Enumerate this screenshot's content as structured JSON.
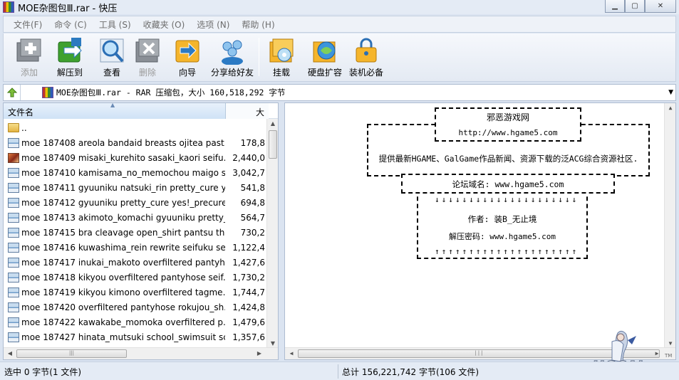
{
  "window": {
    "title": "MOE杂图包Ⅲ.rar - 快压"
  },
  "menu": [
    "文件(F)",
    "命令 (C)",
    "工具 (S)",
    "收藏夹 (O)",
    "选项 (N)",
    "帮助 (H)"
  ],
  "toolbar": {
    "add": "添加",
    "extract": "解压到",
    "view": "查看",
    "delete": "删除",
    "wizard": "向导",
    "share": "分享给好友",
    "mount": "挂载",
    "disk": "硬盘扩容",
    "essentials": "装机必备"
  },
  "address": {
    "text": "MOE杂图包Ⅲ.rar - RAR 压缩包，大小 160,518,292 字节"
  },
  "filelist": {
    "col_name": "文件名",
    "col_size": "大",
    "parent": "..",
    "rows": [
      {
        "icon": "image",
        "name": "moe 187408 areola bandaid breasts ojitea past...",
        "size": "178,8"
      },
      {
        "icon": "photo",
        "name": "moe 187409 misaki_kurehito sasaki_kaori seifu...",
        "size": "2,440,0"
      },
      {
        "icon": "image",
        "name": "moe 187410 kamisama_no_memochou maigo s...",
        "size": "3,042,7"
      },
      {
        "icon": "image",
        "name": "moe 187411 gyuuniku natsuki_rin pretty_cure y...",
        "size": "541,8"
      },
      {
        "icon": "image",
        "name": "moe 187412 gyuuniku pretty_cure yes!_precure...",
        "size": "694,8"
      },
      {
        "icon": "image",
        "name": "moe 187413 akimoto_komachi gyuuniku pretty_...",
        "size": "564,7"
      },
      {
        "icon": "image",
        "name": "moe 187415 bra cleavage open_shirt pantsu thi...",
        "size": "730,2"
      },
      {
        "icon": "image",
        "name": "moe 187416 kuwashima_rein rewrite seifuku se...",
        "size": "1,122,4"
      },
      {
        "icon": "image",
        "name": "moe 187417 inukai_makoto overfiltered pantyh...",
        "size": "1,427,6"
      },
      {
        "icon": "image",
        "name": "moe 187418 kikyou overfiltered pantyhose seif...",
        "size": "1,730,2"
      },
      {
        "icon": "image",
        "name": "moe 187419 kikyou kimono overfiltered tagme...",
        "size": "1,744,7"
      },
      {
        "icon": "image",
        "name": "moe 187420 overfiltered pantyhose rokujou_sh...",
        "size": "1,424,8"
      },
      {
        "icon": "image",
        "name": "moe 187422 kawakabe_momoka overfiltered p...",
        "size": "1,479,6"
      },
      {
        "icon": "image",
        "name": "moe 187427 hinata_mutsuki school_swimsuit sc...",
        "size": "1,357,6"
      }
    ]
  },
  "comment": {
    "site_name": "邪恶游戏网",
    "site_url": "http://www.hgame5.com",
    "description": "提供最新HGAME、GalGame作品新闻、资源下载的泛ACG综合资源社区.",
    "forum": "论坛域名: www.hgame5.com",
    "down_arrows": "↓↓↓↓↓↓↓↓↓↓↓↓↓↓↓↓↓↓↓↓↓",
    "author": "作者: 装B_无止境",
    "password": "解压密码: www.hgame5.com",
    "up_arrows": "↑↑↑↑↑↑↑↑↑↑↑↑↑↑↑↑↑↑↑↑↑"
  },
  "watermark": {
    "text": "HGCAL",
    "tm": "TM"
  },
  "status": {
    "selected": "选中  0 字节(1 文件)",
    "total": "总计  156,221,742 字节(106 文件)"
  }
}
